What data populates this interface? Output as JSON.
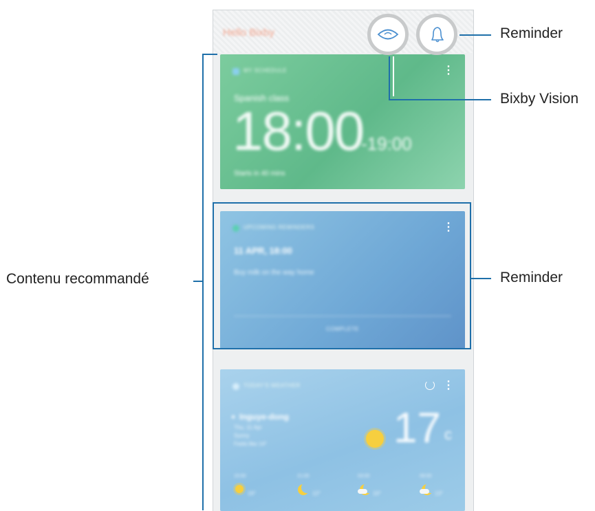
{
  "app": {
    "title": "Hello Bixby"
  },
  "cards": {
    "schedule": {
      "header": "MY SCHEDULE",
      "subtitle": "Spanish class",
      "start_time": "18:00",
      "end_time": "-19:00",
      "status": "Starts in 40 mins"
    },
    "reminder": {
      "header": "UPCOMING REMINDERS",
      "date": "11 APR, 18:00",
      "text": "Buy milk on the way home",
      "action": "COMPLETE"
    },
    "weather": {
      "header": "TODAY'S WEATHER",
      "location": "Inguye-dong",
      "date_line": "Thu, 11 Apr",
      "condition": "Sunny",
      "feels_like": "Feels like 14°",
      "temperature": "17",
      "unit": "c",
      "forecast": [
        {
          "time": "15:00",
          "temp": "16°"
        },
        {
          "time": "21:00",
          "temp": "12°"
        },
        {
          "time": "03:00",
          "temp": "10°"
        },
        {
          "time": "09:00",
          "temp": "13°"
        }
      ]
    }
  },
  "callouts": {
    "reminder_top": "Reminder",
    "bixby_vision": "Bixby Vision",
    "recommended_content": "Contenu recommandé",
    "reminder_card": "Reminder"
  },
  "icons": {
    "vision": "eye-icon",
    "reminder": "bell-icon",
    "more": "more-vert-icon",
    "refresh": "refresh-icon",
    "location": "location-pin-icon"
  },
  "colors": {
    "callout_line": "#1e6fa9",
    "schedule_card": "#6cc294",
    "reminder_card": "#7db5dd",
    "weather_card": "#9ccbe8"
  }
}
